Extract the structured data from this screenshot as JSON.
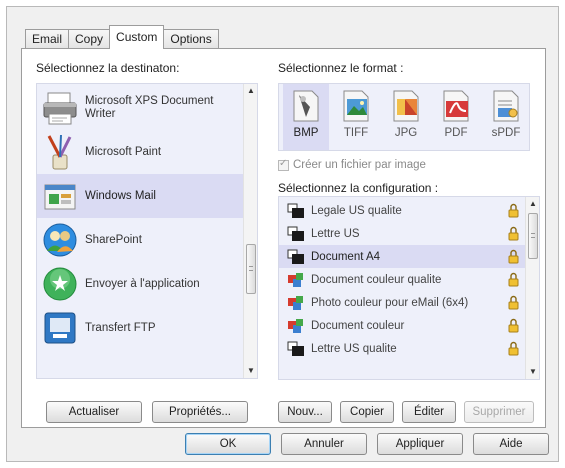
{
  "tabs": [
    {
      "label": "Email"
    },
    {
      "label": "Copy"
    },
    {
      "label": "Custom"
    },
    {
      "label": "Options"
    }
  ],
  "destination": {
    "label": "Sélectionnez la destinaton:",
    "items": [
      {
        "label": "Microsoft XPS Document Writer",
        "icon": "printer-icon"
      },
      {
        "label": "Microsoft Paint",
        "icon": "paint-brushes-icon"
      },
      {
        "label": "Windows Mail",
        "icon": "windows-mail-icon",
        "selected": true
      },
      {
        "label": "SharePoint",
        "icon": "sharepoint-icon"
      },
      {
        "label": "Envoyer à l'application",
        "icon": "send-to-app-icon"
      },
      {
        "label": "Transfert FTP",
        "icon": "ftp-transfer-icon"
      }
    ]
  },
  "format": {
    "label": "Sélectionnez le format :",
    "items": [
      {
        "label": "BMP",
        "icon": "bmp-file-icon",
        "selected": true
      },
      {
        "label": "TIFF",
        "icon": "tiff-file-icon"
      },
      {
        "label": "JPG",
        "icon": "jpg-file-icon"
      },
      {
        "label": "PDF",
        "icon": "pdf-file-icon"
      },
      {
        "label": "sPDF",
        "icon": "spdf-file-icon"
      }
    ],
    "checkbox_label": "Créer un fichier par image",
    "checkbox_checked": true
  },
  "configuration": {
    "label": "Sélectionnez la configuration :",
    "items": [
      {
        "label": "Legale US qualite",
        "icon": "bw-config-icon"
      },
      {
        "label": "Lettre US",
        "icon": "bw-config-icon"
      },
      {
        "label": "Document A4",
        "icon": "bw-config-icon",
        "selected": true
      },
      {
        "label": "Document couleur qualite",
        "icon": "color-config-icon"
      },
      {
        "label": "Photo couleur pour eMail (6x4)",
        "icon": "color-config-icon"
      },
      {
        "label": "Document couleur",
        "icon": "color-config-icon"
      },
      {
        "label": "Lettre US qualite",
        "icon": "bw-config-icon"
      }
    ]
  },
  "buttons": {
    "refresh": "Actualiser",
    "properties": "Propriétés...",
    "new": "Nouv...",
    "copy": "Copier",
    "edit": "Éditer",
    "delete": "Supprimer",
    "ok": "OK",
    "cancel": "Annuler",
    "apply": "Appliquer",
    "help": "Aide"
  },
  "colors": {
    "selection": "#dadbf3",
    "list_background": "#eef0fa",
    "dialog_background": "#f0f0f0"
  }
}
